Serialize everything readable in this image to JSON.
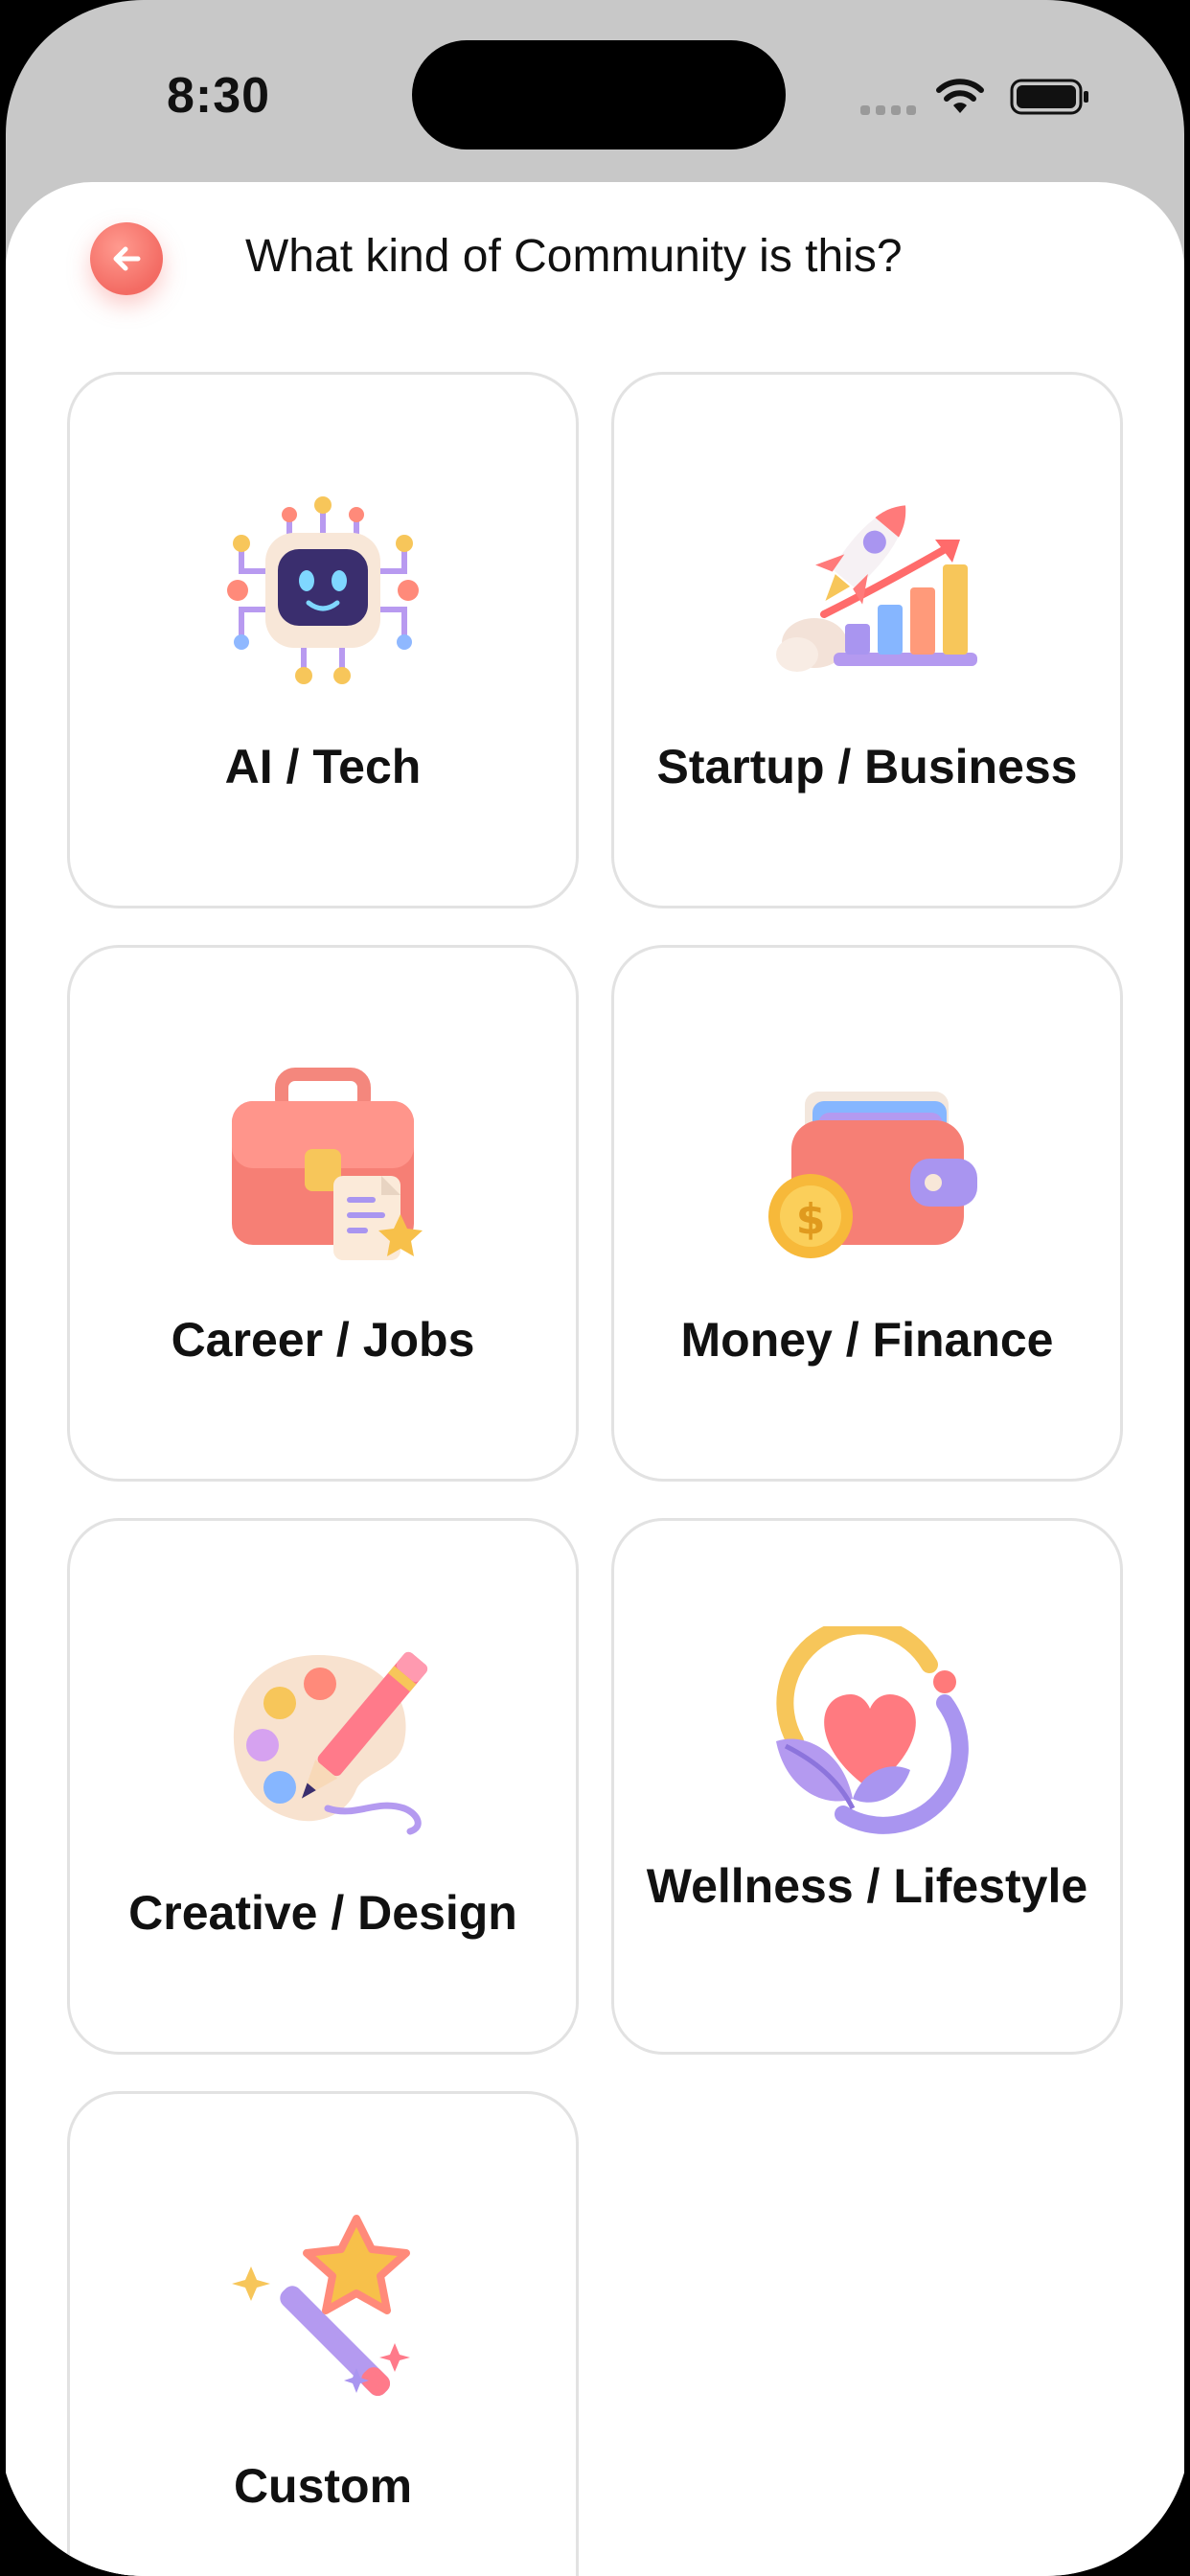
{
  "status_bar": {
    "time": "8:30"
  },
  "header": {
    "title": "What kind of Community is this?"
  },
  "categories": [
    {
      "label": "AI / Tech",
      "icon": "robot-chip-icon"
    },
    {
      "label": "Startup / Business",
      "icon": "rocket-growth-chart-icon"
    },
    {
      "label": "Career / Jobs",
      "icon": "briefcase-document-icon"
    },
    {
      "label": "Money / Finance",
      "icon": "wallet-coin-icon"
    },
    {
      "label": "Creative / Design",
      "icon": "palette-pencil-icon"
    },
    {
      "label": "Wellness / Lifestyle",
      "icon": "heart-leaf-icon"
    },
    {
      "label": "Custom",
      "icon": "magic-wand-star-icon"
    }
  ],
  "colors": {
    "accent": "#f36b63",
    "card_border": "#e2e2e2",
    "background": "#ffffff"
  }
}
